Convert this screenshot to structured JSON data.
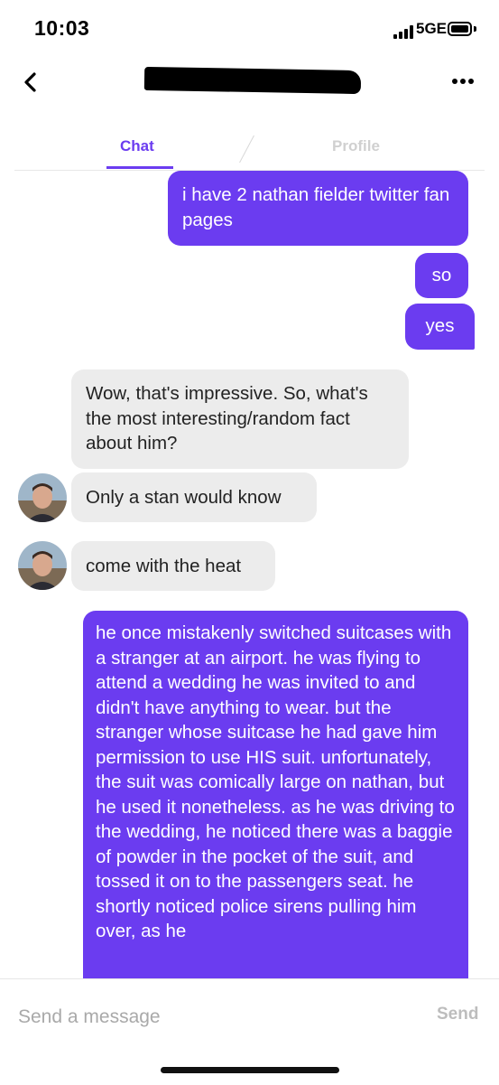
{
  "status_bar": {
    "time": "10:03",
    "network": "5GE"
  },
  "header": {
    "back_icon": "chevron-left-icon",
    "more_icon": "more-horizontal-icon"
  },
  "tabs": [
    {
      "label": "Chat",
      "active": true
    },
    {
      "label": "Profile",
      "active": false
    }
  ],
  "messages": [
    {
      "sender": "me",
      "text": "i have 2 nathan fielder twitter fan pages"
    },
    {
      "sender": "me",
      "text": "so"
    },
    {
      "sender": "me",
      "text": "yes"
    },
    {
      "sender": "them",
      "text": "Wow, that's impressive. So, what's the most interesting/random fact about him?"
    },
    {
      "sender": "them",
      "text": "Only a stan would know"
    },
    {
      "sender": "them",
      "text": "come with the heat"
    },
    {
      "sender": "me",
      "text": "he once mistakenly switched suitcases with a stranger at an airport. he was flying to attend a wedding he was invited to and didn't have anything to wear. but the stranger whose suitcase he had gave him permission to use HIS suit. unfortunately, the suit was comically large on nathan, but he used it nonetheless. as he was driving to the wedding, he noticed there was a baggie of powder in the pocket of the suit, and tossed it on to the passengers seat. he shortly noticed police sirens pulling him over, as he"
    }
  ],
  "composer": {
    "placeholder": "Send a message",
    "send_label": "Send"
  },
  "colors": {
    "accent": "#6b3cf0",
    "incoming_bubble": "#ececec",
    "inactive_tab": "#d0d0d0"
  }
}
